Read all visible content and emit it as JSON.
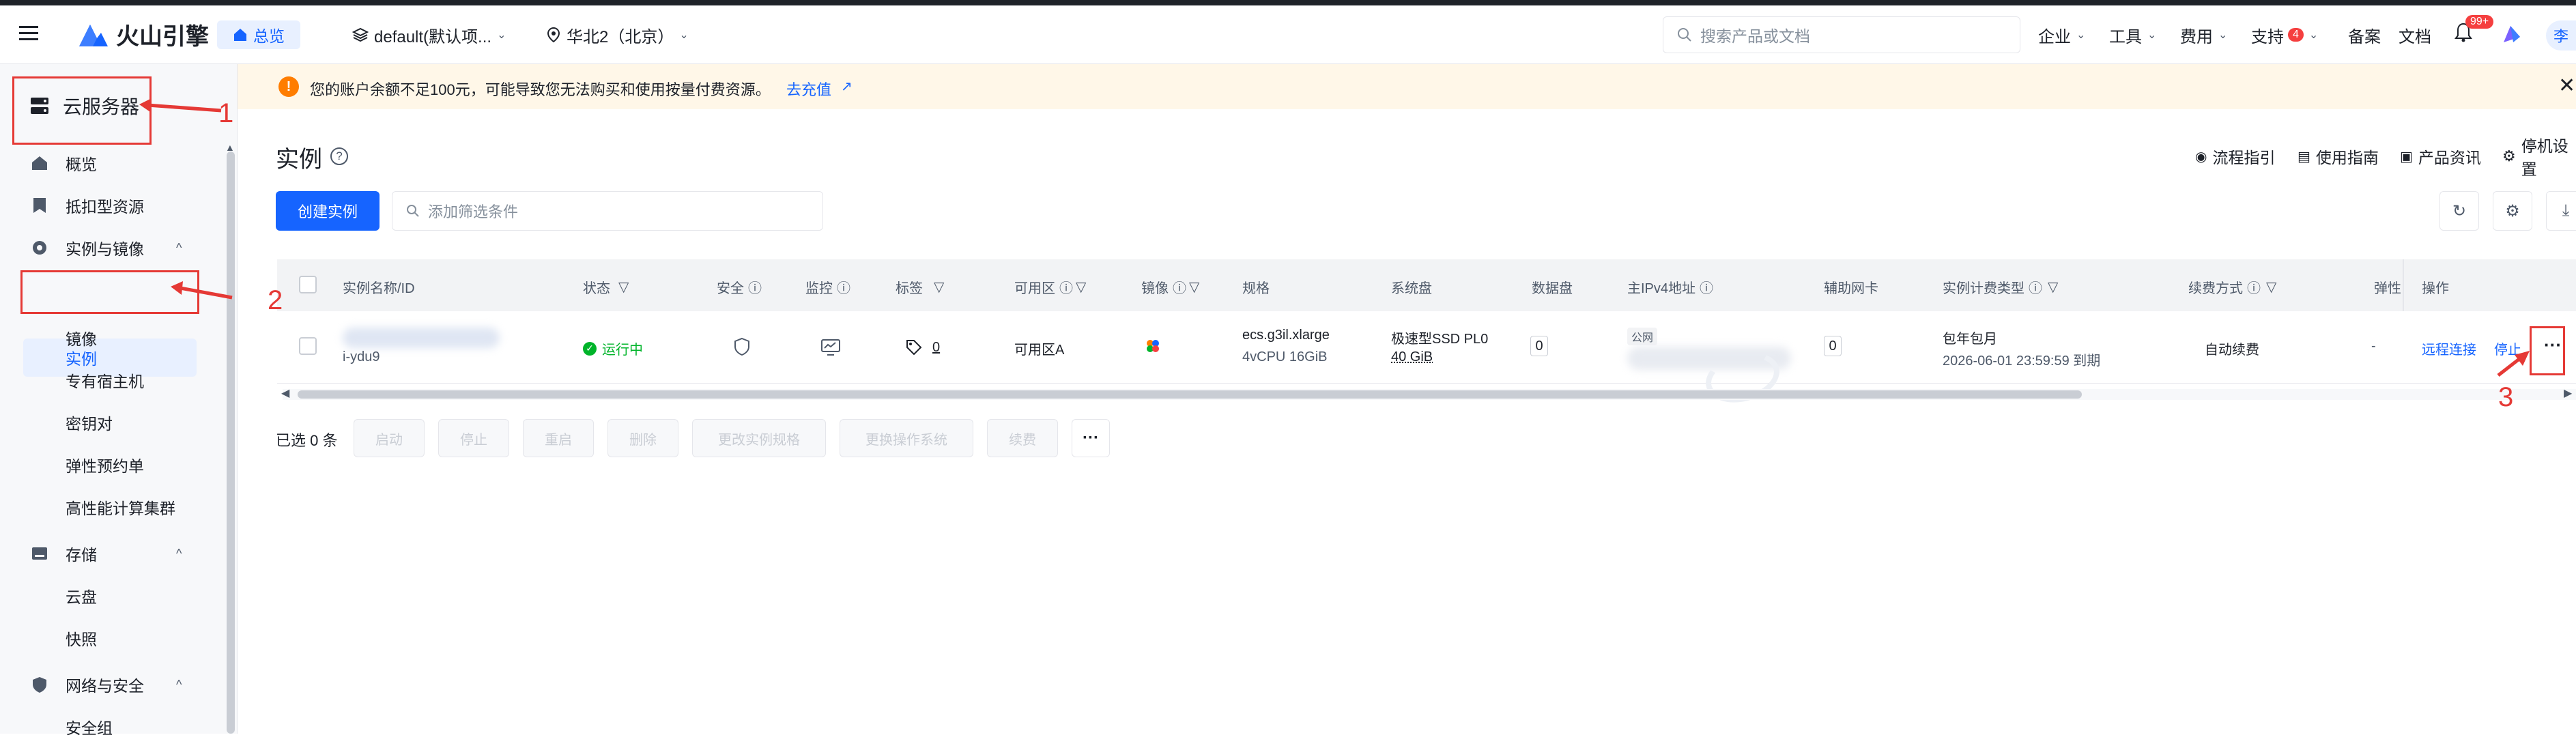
{
  "header": {
    "brand": "火山引擎",
    "home_tab": "总览",
    "project": "default(默认项...",
    "region": "华北2（北京）",
    "search_placeholder": "搜索产品或文档",
    "nav": [
      "企业",
      "工具",
      "费用",
      "支持",
      "备案",
      "文档"
    ],
    "support_badge": "4",
    "bell_badge": "99+",
    "avatar_text": "李"
  },
  "sidebar": {
    "title": "云服务器",
    "items": [
      {
        "label": "概览",
        "icon": "home-icon"
      },
      {
        "label": "抵扣型资源",
        "icon": "bookmark-icon"
      },
      {
        "label": "实例与镜像",
        "icon": "gear-icon"
      },
      {
        "label": "实例"
      },
      {
        "label": "镜像"
      },
      {
        "label": "专有宿主机"
      },
      {
        "label": "密钥对"
      },
      {
        "label": "弹性预约单"
      },
      {
        "label": "高性能计算集群"
      },
      {
        "label": "存储",
        "icon": "drive-icon"
      },
      {
        "label": "云盘"
      },
      {
        "label": "快照"
      },
      {
        "label": "网络与安全",
        "icon": "shield-icon"
      },
      {
        "label": "安全组"
      }
    ]
  },
  "notice": {
    "text": "您的账户余额不足100元，可能导致您无法购买和使用按量付费资源。",
    "link": "去充值"
  },
  "page": {
    "title": "实例",
    "links": [
      "流程指引",
      "使用指南",
      "产品资讯",
      "停机设置"
    ],
    "create_button": "创建实例",
    "filter_placeholder": "添加筛选条件"
  },
  "table": {
    "headers": [
      "实例名称/ID",
      "状态",
      "安全",
      "监控",
      "标签",
      "可用区",
      "镜像",
      "规格",
      "系统盘",
      "数据盘",
      "主IPv4地址",
      "辅助网卡",
      "实例计费类型",
      "续费方式",
      "弹性",
      "操作"
    ],
    "row": {
      "id_partial": "i-ydu9",
      "status": "运行中",
      "tag_count": "0",
      "zone": "可用区A",
      "spec_name": "ecs.g3il.xlarge",
      "spec_detail": "4vCPU 16GiB",
      "sys_disk_type": "极速型SSD PL0",
      "sys_disk_size": "40 GiB",
      "data_disk": "0",
      "ip_tag": "公网",
      "nic": "0",
      "billing_type": "包年包月",
      "expire": "2026-06-01 23:59:59 到期",
      "renew": "自动续费",
      "elastic": "-",
      "action_remote": "远程连接",
      "action_stop": "停止",
      "action_more": "···"
    }
  },
  "footer": {
    "selected": "已选 0 条",
    "buttons": [
      "启动",
      "停止",
      "重启",
      "删除",
      "更改实例规格",
      "更换操作系统",
      "续费"
    ],
    "more": "···"
  },
  "annotations": [
    "1",
    "2",
    "3"
  ],
  "colors": {
    "primary": "#1664ff",
    "annotation": "#e53935",
    "success": "#00b42a",
    "warning_bg": "#fff7e8",
    "warning": "#ff7d00"
  }
}
